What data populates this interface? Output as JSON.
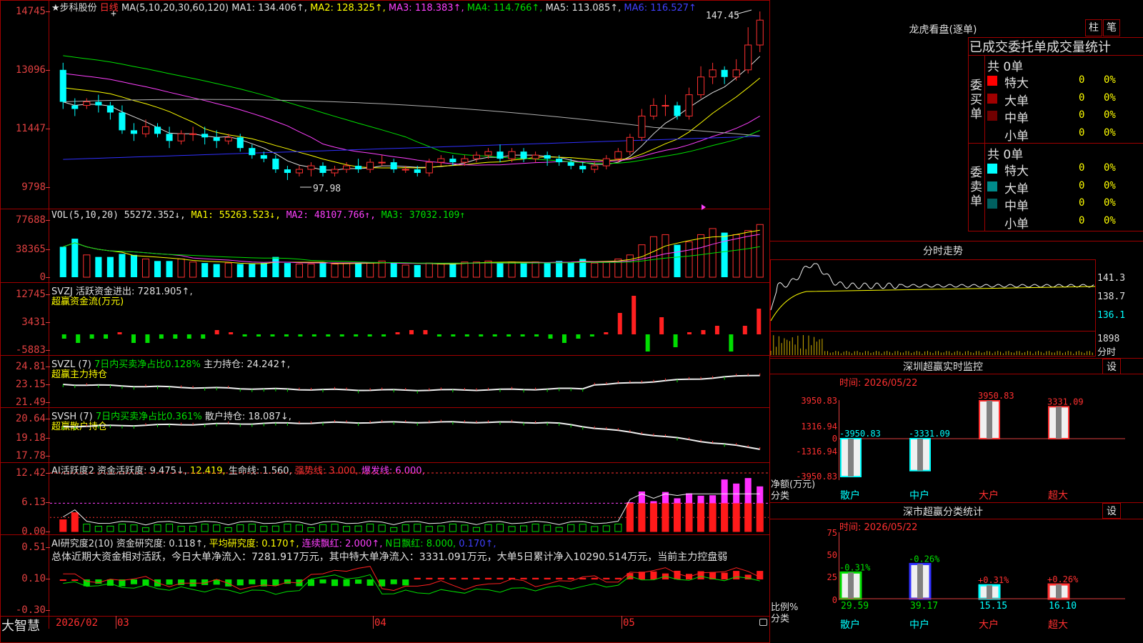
{
  "app": {
    "logo": "大智慧"
  },
  "main_header": {
    "stock_name": "★步科股份",
    "period": "日线",
    "ma_params": "MA(5,10,20,30,60,120)",
    "ma1": "MA1: 134.406↑,",
    "ma2": "MA2: 128.325↑,",
    "ma3": "MA3: 118.383↑,",
    "ma4": "MA4: 114.766↑,",
    "ma5": "MA5: 113.085↑,",
    "ma6": "MA6: 116.527↑",
    "cursor_mark": "+",
    "high_label": "147.45",
    "low_label": "97.98"
  },
  "price_axis": [
    "14745",
    "13096",
    "11447",
    "9798"
  ],
  "vol_panel": {
    "header": "VOL(5,10,20)",
    "val": "55272.352↓,",
    "ma1": "MA1: 55263.523↓,",
    "ma2": "MA2: 48107.766↑,",
    "ma3": "MA3: 37032.109↑",
    "axis": [
      "77688",
      "38365",
      "0"
    ]
  },
  "svzj_panel": {
    "header": "SVZJ  活跃资金进出: 7281.905↑,",
    "sub": "超赢资金流(万元)",
    "axis": [
      "12745",
      "3431",
      "-5883"
    ]
  },
  "svzl_panel": {
    "name": "SVZL (7)",
    "desc": "7日内买卖净占比0.128%",
    "val": "主力持仓: 24.242↑,",
    "sub": "超赢主力持仓",
    "axis": [
      "24.81",
      "23.15",
      "21.49"
    ]
  },
  "svsh_panel": {
    "name": "SVSH (7)",
    "desc": "7日内买卖净占比0.361%",
    "val": "散户持仓: 18.087↓,",
    "sub": "超赢散户持仓",
    "axis": [
      "20.64",
      "19.18",
      "17.78"
    ]
  },
  "ai_active_panel": {
    "name": "AI活跃度2",
    "val": "资金活跃度: 9.475↓,",
    "v2": "12.419,",
    "v3": "生命线: 1.560,",
    "v4": "强势线: 3.000,",
    "v5": "爆发线: 6.000,",
    "axis": [
      "12.42",
      "6.13",
      "0.00"
    ]
  },
  "ai_research_panel": {
    "name": "AI研究度2(10)",
    "val": "资金研究度: 0.118↑,",
    "v2": "平均研究度: 0.170↑,",
    "v3": "连续飘红: 2.000↑,",
    "v4": "N日飘红: 8.000,",
    "v5": "0.170↑,",
    "summary": "总体近期大资金相对活跃，今日大单净流入：7281.917万元，其中特大单净流入：3331.091万元，大单5日累计净入10290.514万元，当前主力控盘弱",
    "axis": [
      "0.51",
      "0.10",
      "-0.30"
    ]
  },
  "time_axis": [
    "2026/02",
    "03",
    "04",
    "05"
  ],
  "lhb": {
    "title": "龙虎看盘(逐单)",
    "btn1": "柱",
    "btn2": "笔",
    "stat_title": "已成交委托单成交量统计",
    "buy_label": "委买单",
    "sell_label": "委卖单",
    "buy_total": "共 0单",
    "sell_total": "共 0单",
    "buy_rows": [
      {
        "name": "特大",
        "val": "0",
        "pct": "0%",
        "color": "#ff0000"
      },
      {
        "name": "大单",
        "val": "0",
        "pct": "0%",
        "color": "#a00000"
      },
      {
        "name": "中单",
        "val": "0",
        "pct": "0%",
        "color": "#700000"
      },
      {
        "name": "小单",
        "val": "0",
        "pct": "0%",
        "color": "#000000"
      }
    ],
    "sell_rows": [
      {
        "name": "特大",
        "val": "0",
        "pct": "0%",
        "color": "#00ffff"
      },
      {
        "name": "大单",
        "val": "0",
        "pct": "0%",
        "color": "#008b8b"
      },
      {
        "name": "中单",
        "val": "0",
        "pct": "0%",
        "color": "#006060"
      },
      {
        "name": "小单",
        "val": "0",
        "pct": "0%",
        "color": "#000000"
      }
    ]
  },
  "intraday": {
    "title": "分时走势",
    "axis": [
      "141.3",
      "138.7",
      "136.1",
      "1898"
    ],
    "vol_label": "分时"
  },
  "monitor": {
    "title": "深圳超赢实时监控",
    "btn": "设",
    "time": "时间: 2026/05/22",
    "axis": [
      "3950.83",
      "1316.94",
      "0",
      "-1316.94",
      "-3950.83"
    ],
    "y_label": "净额(万元)",
    "x_label": "分类",
    "categories": [
      "散户",
      "中户",
      "大户",
      "超大"
    ],
    "bar_labels": [
      "-3950.83",
      "-3331.09",
      "3950.83",
      "3331.09"
    ]
  },
  "classify": {
    "title": "深市超赢分类统计",
    "btn": "设",
    "time": "时间: 2026/05/22",
    "axis": [
      "75",
      "50",
      "25",
      "0"
    ],
    "y_label": "比例%",
    "x_label": "分类",
    "categories": [
      "散户",
      "中户",
      "大户",
      "超大"
    ],
    "top_labels": [
      "-0.31%",
      "-0.26%",
      "+0.31%",
      "+0.26%"
    ],
    "bottom_labels": [
      "29.59",
      "39.17",
      "15.15",
      "16.10"
    ]
  },
  "chart_data": {
    "type": "candlestick",
    "x_labels": [
      "2026/02",
      "03",
      "04",
      "05"
    ],
    "price_ylim": [
      9798,
      14745
    ],
    "candles": [
      [
        131,
        122,
        133,
        120
      ],
      [
        121,
        120,
        123,
        118
      ],
      [
        121,
        122,
        123,
        120
      ],
      [
        122,
        121,
        124,
        119
      ],
      [
        121,
        119,
        122,
        117
      ],
      [
        119,
        114,
        121,
        113
      ],
      [
        114,
        113,
        116,
        111
      ],
      [
        113,
        115,
        117,
        112
      ],
      [
        115,
        113,
        116,
        112
      ],
      [
        113,
        111,
        115,
        109
      ],
      [
        111,
        113,
        114,
        110
      ],
      [
        113,
        113,
        115,
        111
      ],
      [
        113,
        112,
        115,
        110
      ],
      [
        112,
        111,
        114,
        109
      ],
      [
        111,
        112,
        113,
        110
      ],
      [
        112,
        109,
        113,
        108
      ],
      [
        109,
        107,
        110,
        106
      ],
      [
        107,
        106,
        108,
        105
      ],
      [
        106,
        103,
        107,
        102
      ],
      [
        103,
        102,
        104,
        100
      ],
      [
        102,
        103,
        104,
        101
      ],
      [
        103,
        104,
        105,
        101
      ],
      [
        104,
        102,
        105,
        101
      ],
      [
        102,
        103,
        104,
        101
      ],
      [
        103,
        104,
        105,
        102
      ],
      [
        104,
        103,
        106,
        102
      ],
      [
        103,
        105,
        106,
        102
      ],
      [
        105,
        105,
        107,
        104
      ],
      [
        105,
        103,
        106,
        102
      ],
      [
        103,
        103,
        104,
        102
      ],
      [
        103,
        102,
        104,
        101
      ],
      [
        102,
        105,
        106,
        101
      ],
      [
        105,
        106,
        107,
        104
      ],
      [
        106,
        105,
        107,
        104
      ],
      [
        105,
        106,
        107,
        104
      ],
      [
        106,
        107,
        108,
        105
      ],
      [
        107,
        108,
        109,
        106
      ],
      [
        108,
        106,
        110,
        105
      ],
      [
        106,
        108,
        109,
        105
      ],
      [
        108,
        106,
        109,
        105
      ],
      [
        106,
        107,
        108,
        105
      ],
      [
        107,
        106,
        108,
        104
      ],
      [
        106,
        105,
        107,
        104
      ],
      [
        105,
        104,
        106,
        103
      ],
      [
        104,
        103,
        105,
        102
      ],
      [
        103,
        104,
        105,
        102
      ],
      [
        104,
        106,
        107,
        103
      ],
      [
        106,
        108,
        109,
        105
      ],
      [
        108,
        112,
        113,
        107
      ],
      [
        112,
        118,
        120,
        111
      ],
      [
        118,
        121,
        123,
        117
      ],
      [
        121,
        121,
        124,
        118
      ],
      [
        121,
        118,
        122,
        117
      ],
      [
        118,
        124,
        126,
        117
      ],
      [
        124,
        129,
        132,
        123
      ],
      [
        129,
        131,
        133,
        127
      ],
      [
        131,
        129,
        132,
        127
      ],
      [
        129,
        131,
        134,
        128
      ],
      [
        131,
        138,
        143,
        130
      ],
      [
        138,
        145,
        147.45,
        136
      ]
    ],
    "vol_ylim": [
      0,
      77688
    ],
    "volumes": [
      30,
      38,
      22,
      20,
      20,
      23,
      22,
      18,
      16,
      16,
      18,
      15,
      14,
      13,
      14,
      13,
      13,
      14,
      20,
      14,
      13,
      13,
      14,
      13,
      14,
      14,
      14,
      16,
      14,
      12,
      12,
      14,
      13,
      14,
      15,
      15,
      16,
      14,
      15,
      14,
      15,
      14,
      16,
      15,
      18,
      14,
      15,
      18,
      22,
      32,
      40,
      42,
      32,
      35,
      42,
      48,
      44,
      42,
      46,
      52
    ],
    "svzj_ylim": [
      -5883,
      12745
    ],
    "svzj": [
      -1,
      -2,
      -1,
      -1,
      0.5,
      -2,
      -2,
      -1,
      -1,
      -1,
      -1,
      1,
      0.5,
      -0.5,
      -0.5,
      -0.5,
      -0.5,
      -0.5,
      -0.5,
      -0.5,
      -0.5,
      -0.5,
      -0.5,
      -0.5,
      0.5,
      1,
      1,
      -0.5,
      -0.5,
      -0.5,
      -0.5,
      -0.5,
      -0.5,
      -0.5,
      -0.5,
      -1,
      -2,
      -1,
      -0.5,
      0.5,
      5,
      9,
      -4,
      4,
      -3,
      0.5,
      1,
      2,
      -4,
      2,
      6
    ],
    "svzl_ylim": [
      21.49,
      24.81
    ],
    "svsh_ylim": [
      17.78,
      20.64
    ],
    "ai_active_ylim": [
      0,
      12.42
    ],
    "ai_research_ylim": [
      -0.3,
      0.51
    ]
  }
}
